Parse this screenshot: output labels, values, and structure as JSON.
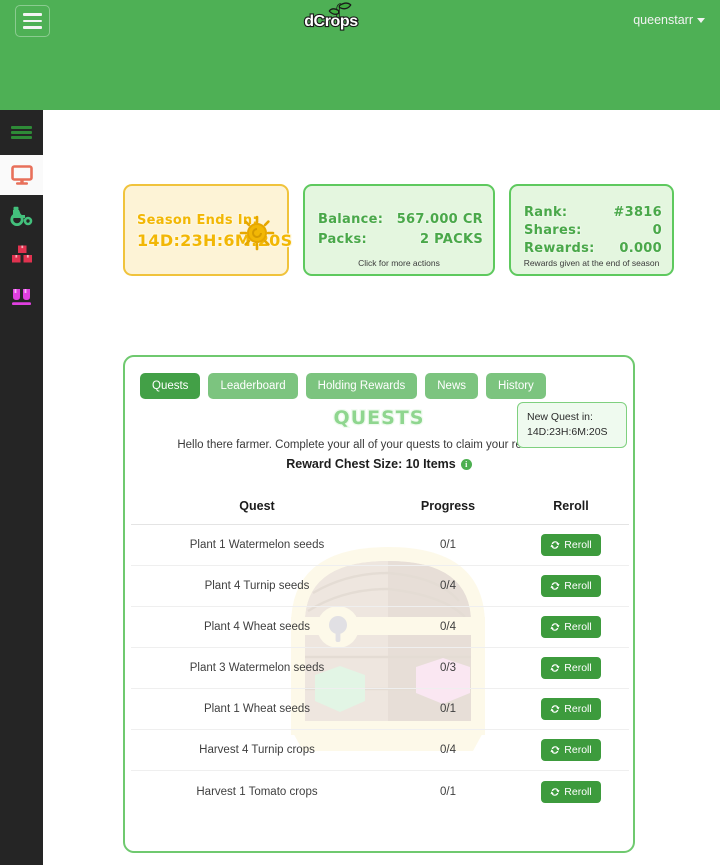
{
  "header": {
    "menu_icon": "hamburger-icon",
    "logo_text": "dCrops",
    "logo_icon": "sprout-icon",
    "username": "queenstarr",
    "caret_icon": "chevron-down-icon"
  },
  "sidebar": {
    "toggle_icon": "hamburger-icon",
    "items": [
      {
        "name": "dashboard",
        "icon": "monitor-icon",
        "color": "#e8705a",
        "active": true
      },
      {
        "name": "farm",
        "icon": "tractor-icon",
        "color": "#43c07c",
        "active": false
      },
      {
        "name": "inventory",
        "icon": "boxes-icon",
        "color": "#e0324f",
        "active": false
      },
      {
        "name": "market",
        "icon": "seedlings-icon",
        "color": "#e040e0",
        "active": false
      }
    ]
  },
  "cards": {
    "season": {
      "title": "Season Ends In:",
      "time": "14D:23H:6M:20S",
      "icon": "sun-icon",
      "border_color": "#f0c33c",
      "bg_color": "#fdf3d6"
    },
    "balance": {
      "label_balance": "Balance:",
      "label_packs": "Packs:",
      "value_balance": "567.000 CR",
      "value_packs": "2 PACKS",
      "note": "Click for more actions",
      "border_color": "#5ec95e",
      "bg_color": "#e4f6df"
    },
    "rank": {
      "label_rank": "Rank:",
      "label_shares": "Shares:",
      "label_rewards": "Rewards:",
      "value_rank": "#3816",
      "value_shares": "0",
      "value_rewards": "0.000",
      "note": "Rewards given at the end of season",
      "border_color": "#5ec95e",
      "bg_color": "#e4f6df"
    }
  },
  "panel": {
    "tabs": [
      {
        "label": "Quests",
        "active": true
      },
      {
        "label": "Leaderboard",
        "active": false
      },
      {
        "label": "Holding Rewards",
        "active": false
      },
      {
        "label": "News",
        "active": false
      },
      {
        "label": "History",
        "active": false
      }
    ],
    "title": "QUESTS",
    "subtitle": "Hello there farmer. Complete your all of your quests to claim your reward chest.",
    "chest_size_label": "Reward Chest Size: 10 Items",
    "info_icon": "info-icon",
    "new_quest": {
      "label": "New Quest in:",
      "time": "14D:23H:6M:20S"
    },
    "table": {
      "columns": [
        "Quest",
        "Progress",
        "Reroll"
      ],
      "reroll_label": "Reroll",
      "reroll_icon": "refresh-icon",
      "rows": [
        {
          "quest": "Plant 1 Watermelon seeds",
          "progress": "0/1"
        },
        {
          "quest": "Plant 4 Turnip seeds",
          "progress": "0/4"
        },
        {
          "quest": "Plant 4 Wheat seeds",
          "progress": "0/4"
        },
        {
          "quest": "Plant 3 Watermelon seeds",
          "progress": "0/3"
        },
        {
          "quest": "Plant 1 Wheat seeds",
          "progress": "0/1"
        },
        {
          "quest": "Harvest 4 Turnip crops",
          "progress": "0/4"
        },
        {
          "quest": "Harvest 1 Tomato crops",
          "progress": "0/1"
        }
      ]
    },
    "watermark_icon": "treasure-chest-icon"
  },
  "theme": {
    "brand_green": "#4eb055",
    "accent_green": "#43a047",
    "sidebar_dark": "#252525"
  }
}
